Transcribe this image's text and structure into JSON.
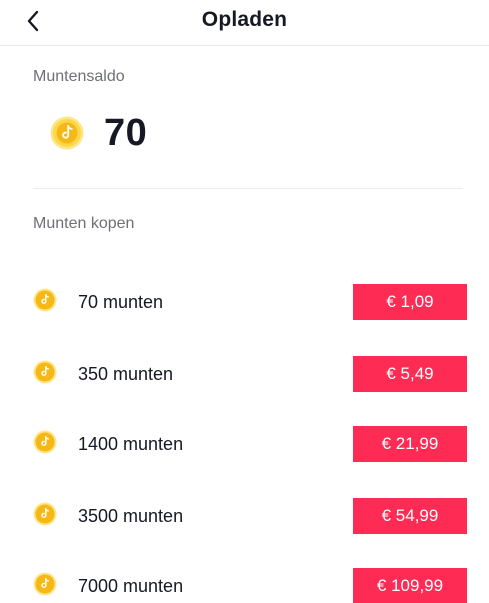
{
  "header": {
    "title": "Opladen",
    "back_icon": "chevron-left-icon"
  },
  "balance": {
    "label": "Muntensaldo",
    "value": "70",
    "icon": "coin-icon"
  },
  "buy": {
    "label": "Munten kopen"
  },
  "packages": [
    {
      "label": "70 munten",
      "price": "€ 1,09"
    },
    {
      "label": "350 munten",
      "price": "€ 5,49"
    },
    {
      "label": "1400 munten",
      "price": "€ 21,99"
    },
    {
      "label": "3500 munten",
      "price": "€ 54,99"
    },
    {
      "label": "7000 munten",
      "price": "€ 109,99"
    }
  ],
  "colors": {
    "accent": "#fe2c55",
    "coin_outer": "#fbd84a",
    "coin_inner": "#f6b816"
  }
}
